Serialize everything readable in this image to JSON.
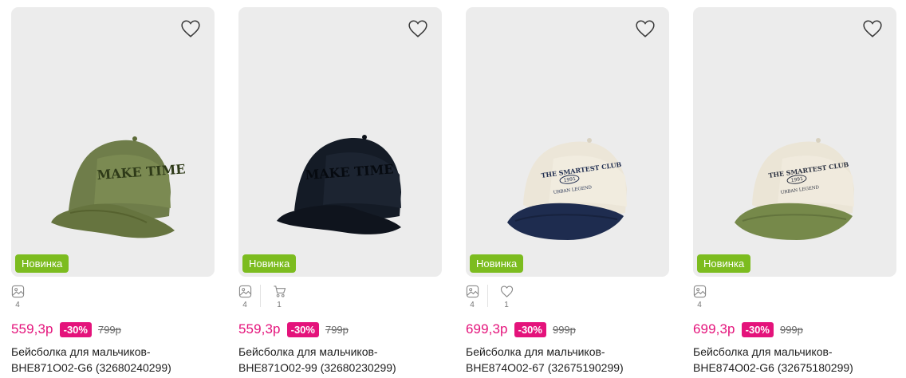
{
  "colors": {
    "price": "#e4137b",
    "discount_bg": "#e4137b",
    "badge_new": "#7cbc1f",
    "card_bg": "#ececec"
  },
  "icons": {
    "favorite": "heart-outline-icon",
    "photos": "image-icon",
    "cart": "cart-icon",
    "likes": "heart-outline-icon"
  },
  "products": [
    {
      "badge": "Новинка",
      "photo_count": "4",
      "price": "559,3р",
      "discount": "-30%",
      "old_price": "799р",
      "title_line1": "Бейсболка для мальчиков-",
      "title_line2": "BHE871O02-G6 (32680240299)",
      "cap_text": "MAKE TIME"
    },
    {
      "badge": "Новинка",
      "photo_count": "4",
      "cart_count": "1",
      "price": "559,3р",
      "discount": "-30%",
      "old_price": "799р",
      "title_line1": "Бейсболка для мальчиков-",
      "title_line2": "BHE871O02-99 (32680230299)",
      "cap_text": "MAKE TIME"
    },
    {
      "badge": "Новинка",
      "photo_count": "4",
      "likes_count": "1",
      "price": "699,3р",
      "discount": "-30%",
      "old_price": "999р",
      "title_line1": "Бейсболка для мальчиков-",
      "title_line2": "BHE874O02-67 (32675190299)",
      "cap_text": "THE SMARTEST CLUB",
      "cap_year": "1991",
      "cap_sub": "URBAN LEGEND"
    },
    {
      "badge": "Новинка",
      "photo_count": "4",
      "price": "699,3р",
      "discount": "-30%",
      "old_price": "999р",
      "title_line1": "Бейсболка для мальчиков-",
      "title_line2": "BHE874O02-G6 (32675180299)",
      "cap_text": "THE SMARTEST CLUB",
      "cap_year": "1991",
      "cap_sub": "URBAN LEGEND"
    }
  ]
}
